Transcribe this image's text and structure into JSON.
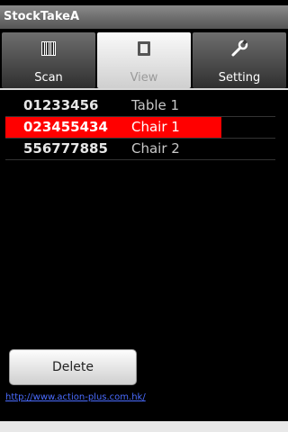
{
  "app": {
    "title": "StockTakeA"
  },
  "tabs": [
    {
      "label": "Scan",
      "icon": "barcode-icon"
    },
    {
      "label": "View",
      "icon": "view-icon"
    },
    {
      "label": "Setting",
      "icon": "wrench-icon"
    }
  ],
  "list": {
    "rows": [
      {
        "code": "01233456",
        "name": "Table 1"
      },
      {
        "code": "023455434",
        "name": "Chair 1"
      },
      {
        "code": "556777885",
        "name": "Chair 2"
      }
    ]
  },
  "actions": {
    "delete_label": "Delete"
  },
  "footer": {
    "link_text": "http://www.action-plus.com.hk/"
  }
}
